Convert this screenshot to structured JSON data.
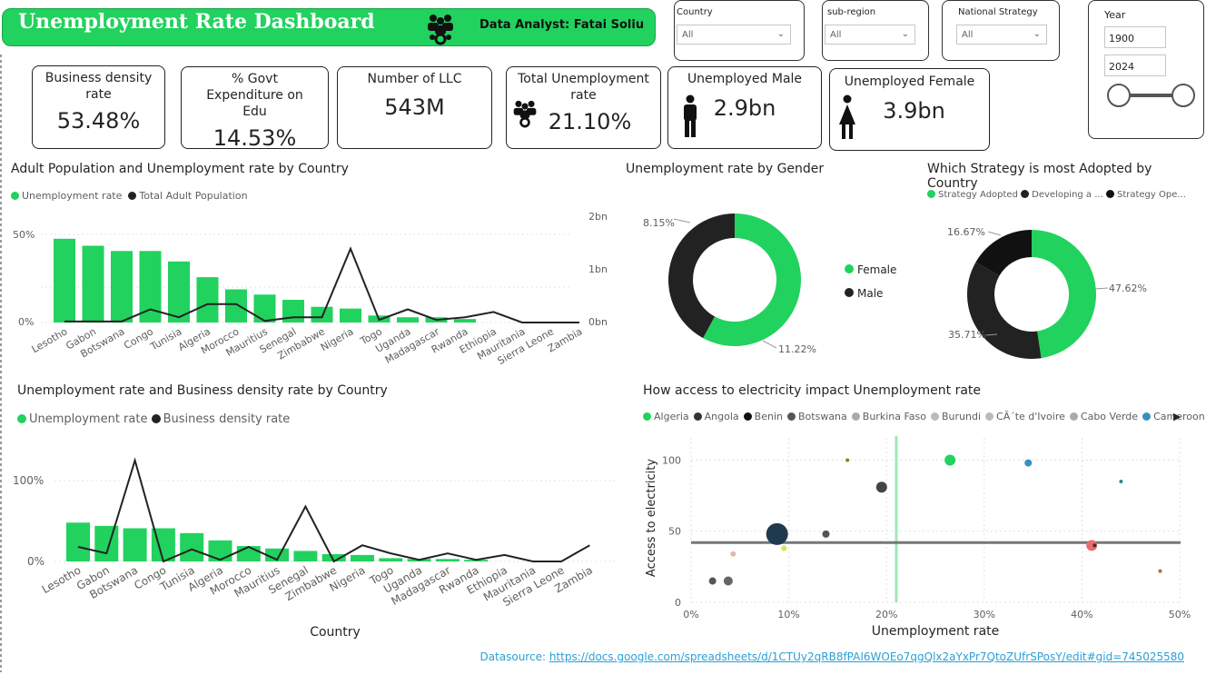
{
  "header": {
    "title": "Unemployment Rate Dashboard",
    "analyst": "Data Analyst: Fatai Soliu",
    "icon": "team-icon"
  },
  "slicers": {
    "country": {
      "label": "Country",
      "value": "All"
    },
    "subregion": {
      "label": "sub-region",
      "value": "All"
    },
    "strategy": {
      "label": "National Strategy",
      "value": "All"
    },
    "year": {
      "label": "Year",
      "from": "1900",
      "to": "2024"
    }
  },
  "cards": [
    {
      "label": "Business density rate",
      "value": "53.48%"
    },
    {
      "label": "% Govt Expenditure on Edu",
      "value": "14.53%"
    },
    {
      "label": "Number of LLC",
      "value": "543M"
    },
    {
      "label": "Total Unemployment rate",
      "value": "21.10%",
      "icon": "team-icon"
    },
    {
      "label": "Unemployed Male",
      "value": "2.9bn",
      "icon": "male-icon"
    },
    {
      "label": "Unemployed Female",
      "value": "3.9bn",
      "icon": "female-icon"
    }
  ],
  "colors": {
    "green": "#21d25e",
    "dark": "#222222",
    "accent_bar": "#21d25e"
  },
  "chart1": {
    "title": "Adult Population and Unemployment rate by Country",
    "legend": [
      "Unemployment rate",
      "Total Adult Population"
    ],
    "yleft_ticks": [
      "50%",
      "0%"
    ],
    "yright_ticks": [
      "2bn",
      "1bn",
      "0bn"
    ]
  },
  "chart2": {
    "title": "Unemployment rate by Gender",
    "legend": [
      "Female",
      "Male"
    ],
    "labels": [
      "8.15%",
      "11.22%"
    ]
  },
  "chart3": {
    "title": "Which Strategy is most Adopted by Country",
    "legend": [
      "Strategy Adopted",
      "Developing a ...",
      "Strategy Ope..."
    ],
    "labels": [
      "16.67%",
      "47.62%",
      "35.71%"
    ]
  },
  "chart4": {
    "title": "Unemployment rate and Business density rate by Country",
    "legend": [
      "Unemployment rate",
      "Business density rate"
    ],
    "y_ticks": [
      "100%",
      "0%"
    ],
    "xlabel": "Country"
  },
  "chart5": {
    "title": "How access to electricity impact Unemployment rate",
    "legend": [
      "Algeria",
      "Angola",
      "Benin",
      "Botswana",
      "Burkina Faso",
      "Burundi",
      "CÃ´te d'Ivoire",
      "Cabo Verde",
      "Cameroon"
    ],
    "legend_colors": [
      "#21d25e",
      "#333333",
      "#111111",
      "#555555",
      "#aaaaaa",
      "#bbbbbb",
      "#bbbbbb",
      "#aaaaaa",
      "#3a8fc0"
    ],
    "xlabel": "Unemployment rate",
    "ylabel": "Access to electricity",
    "x_ticks": [
      "0%",
      "10%",
      "20%",
      "30%",
      "40%",
      "50%"
    ],
    "y_ticks": [
      "100",
      "50",
      "0"
    ]
  },
  "chart_data": [
    {
      "type": "bar",
      "title": "Adult Population and Unemployment rate by Country",
      "categories": [
        "Lesotho",
        "Gabon",
        "Botswana",
        "Congo",
        "Tunisia",
        "Algeria",
        "Morocco",
        "Mauritius",
        "Senegal",
        "Zimbabwe",
        "Nigeria",
        "Togo",
        "Uganda",
        "Madagascar",
        "Rwanda",
        "Ethiopia",
        "Mauritania",
        "Sierra Leone",
        "Zambia"
      ],
      "series": [
        {
          "name": "Unemployment rate",
          "type": "bar",
          "values": [
            48,
            44,
            41,
            41,
            35,
            26,
            19,
            16,
            13,
            9,
            8,
            4,
            3,
            3,
            2,
            0,
            0,
            0,
            0
          ]
        },
        {
          "name": "Total Adult Population",
          "type": "line",
          "values": [
            0.02,
            0.02,
            0.02,
            0.25,
            0.1,
            0.35,
            0.35,
            0.03,
            0.1,
            0.1,
            1.4,
            0.05,
            0.25,
            0.05,
            0.1,
            0.2,
            0.0,
            0.0,
            0.0
          ]
        }
      ],
      "ylim_left": [
        0,
        60
      ],
      "ylim_right": [
        0,
        2
      ]
    },
    {
      "type": "pie",
      "title": "Unemployment rate by Gender",
      "labels": [
        "Female",
        "Male"
      ],
      "values": [
        11.22,
        8.15
      ]
    },
    {
      "type": "pie",
      "title": "Which Strategy is most Adopted by Country",
      "labels": [
        "Strategy Adopted",
        "Developing a ...",
        "Strategy Ope..."
      ],
      "values": [
        47.62,
        35.71,
        16.67
      ]
    },
    {
      "type": "bar",
      "title": "Unemployment rate and Business density rate by Country",
      "xlabel": "Country",
      "categories": [
        "Lesotho",
        "Gabon",
        "Botswana",
        "Congo",
        "Tunisia",
        "Algeria",
        "Morocco",
        "Mauritius",
        "Senegal",
        "Zimbabwe",
        "Nigeria",
        "Togo",
        "Uganda",
        "Madagascar",
        "Rwanda",
        "Ethiopia",
        "Mauritania",
        "Sierra Leone",
        "Zambia"
      ],
      "series": [
        {
          "name": "Unemployment rate",
          "type": "bar",
          "values": [
            48,
            44,
            41,
            41,
            35,
            26,
            19,
            16,
            13,
            9,
            8,
            4,
            3,
            3,
            2,
            0,
            0,
            0,
            0
          ]
        },
        {
          "name": "Business density rate",
          "type": "line",
          "values": [
            18,
            10,
            125,
            0,
            15,
            2,
            18,
            2,
            68,
            0,
            20,
            10,
            2,
            10,
            2,
            8,
            0,
            0,
            20
          ]
        }
      ],
      "ylim": [
        0,
        130
      ]
    },
    {
      "type": "scatter",
      "title": "How access to electricity impact Unemployment rate",
      "xlabel": "Unemployment rate",
      "ylabel": "Access to electricity",
      "xlim": [
        0,
        50
      ],
      "ylim": [
        0,
        115
      ],
      "points": [
        {
          "x": 26.5,
          "y": 100,
          "r": 6,
          "color": "#21d25e"
        },
        {
          "x": 16,
          "y": 100,
          "r": 2,
          "color": "#8a7a30"
        },
        {
          "x": 34.5,
          "y": 98,
          "r": 4,
          "color": "#3a8fc0"
        },
        {
          "x": 44,
          "y": 85,
          "r": 2,
          "color": "#2a8a8a"
        },
        {
          "x": 19.5,
          "y": 81,
          "r": 6,
          "color": "#444444"
        },
        {
          "x": 8.8,
          "y": 48,
          "r": 12,
          "color": "#1f3a4e"
        },
        {
          "x": 13.8,
          "y": 48,
          "r": 4,
          "color": "#555555"
        },
        {
          "x": 9.5,
          "y": 38,
          "r": 3,
          "color": "#d4e357"
        },
        {
          "x": 4.3,
          "y": 34,
          "r": 3,
          "color": "#e0b8a8"
        },
        {
          "x": 2.2,
          "y": 15,
          "r": 4,
          "color": "#555555"
        },
        {
          "x": 3.8,
          "y": 15,
          "r": 5,
          "color": "#666666"
        },
        {
          "x": 41,
          "y": 40,
          "r": 6,
          "color": "#e86c6c"
        },
        {
          "x": 41.3,
          "y": 40,
          "r": 2,
          "color": "#333333"
        },
        {
          "x": 48,
          "y": 22,
          "r": 2,
          "color": "#c0643c"
        }
      ],
      "ref_x": 21,
      "ref_y": 42
    }
  ],
  "footer": {
    "label": "Datasource:",
    "url": "https://docs.google.com/spreadsheets/d/1CTUy2qRB8fPAI6WOEo7qgQlx2aYxPr7QtoZUfrSPosY/edit#gid=745025580"
  }
}
